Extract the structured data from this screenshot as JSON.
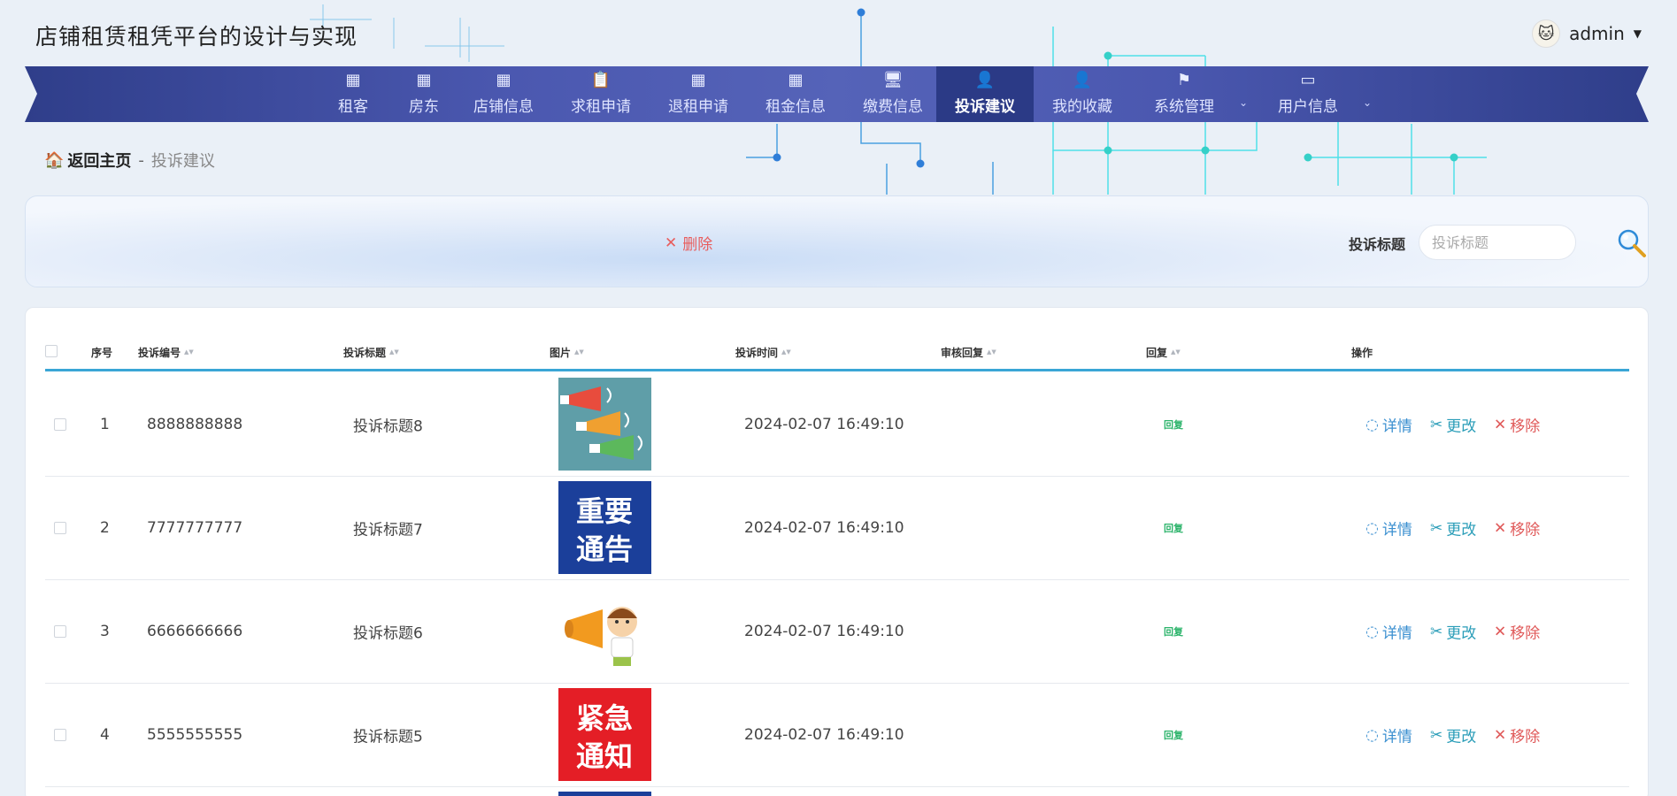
{
  "app": {
    "title": "店铺租赁租凭平台的设计与实现",
    "username": "admin"
  },
  "nav": {
    "items": [
      {
        "label": "租客",
        "icon": "grid-icon"
      },
      {
        "label": "房东",
        "icon": "grid-icon"
      },
      {
        "label": "店铺信息",
        "icon": "grid-icon"
      },
      {
        "label": "求租申请",
        "icon": "clipboard-icon"
      },
      {
        "label": "退租申请",
        "icon": "grid-icon"
      },
      {
        "label": "租金信息",
        "icon": "grid-icon"
      },
      {
        "label": "缴费信息",
        "icon": "monitor-icon"
      },
      {
        "label": "投诉建议",
        "icon": "user-icon",
        "active": true
      },
      {
        "label": "我的收藏",
        "icon": "user-icon"
      },
      {
        "label": "系统管理",
        "icon": "flag-icon",
        "dropdown": true
      },
      {
        "label": "用户信息",
        "icon": "card-icon",
        "dropdown": true
      }
    ]
  },
  "breadcrumb": {
    "home": "返回主页",
    "separator": "-",
    "current": "投诉建议"
  },
  "toolbar": {
    "delete_label": "删除",
    "search_label": "投诉标题",
    "search_placeholder": "投诉标题"
  },
  "table": {
    "headers": {
      "index": "序号",
      "code": "投诉编号",
      "title": "投诉标题",
      "image": "图片",
      "time": "投诉时间",
      "review": "审核回复",
      "reply": "回复",
      "ops": "操作"
    },
    "actions": {
      "detail": "详情",
      "edit": "更改",
      "remove": "移除",
      "reply": "回复"
    },
    "rows": [
      {
        "index": "1",
        "code": "8888888888",
        "title": "投诉标题8",
        "image": "megaphones",
        "time": "2024-02-07 16:49:10",
        "review": ""
      },
      {
        "index": "2",
        "code": "7777777777",
        "title": "投诉标题7",
        "image": "重要通告",
        "time": "2024-02-07 16:49:10",
        "review": ""
      },
      {
        "index": "3",
        "code": "6666666666",
        "title": "投诉标题6",
        "image": "boy-megaphone",
        "time": "2024-02-07 16:49:10",
        "review": ""
      },
      {
        "index": "4",
        "code": "5555555555",
        "title": "投诉标题5",
        "image": "紧急通知",
        "time": "2024-02-07 16:49:10",
        "review": ""
      }
    ]
  },
  "colors": {
    "nav": "#4b58b0",
    "nav_active": "#2b3a86",
    "accent": "#3aa6d6",
    "delete": "#e85d5d",
    "reply": "#2bb36a"
  }
}
